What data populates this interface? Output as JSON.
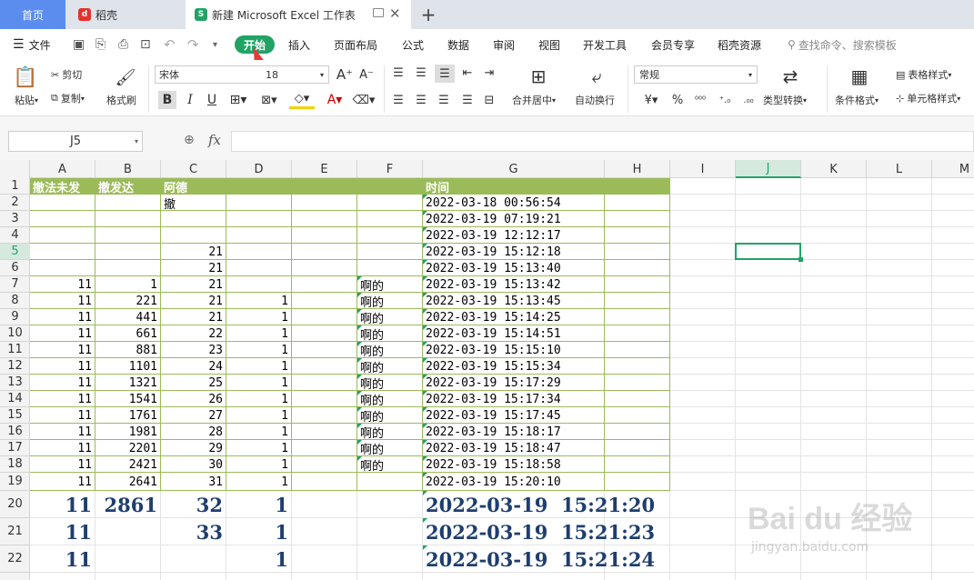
{
  "tabs": {
    "home": "首页",
    "daoke": "稻壳",
    "book": "新建 Microsoft Excel 工作表",
    "book_badge": "S",
    "daoke_badge": "d"
  },
  "menu": {
    "file": "文件",
    "start": "开始",
    "insert": "插入",
    "layout": "页面布局",
    "formula": "公式",
    "data": "数据",
    "review": "审阅",
    "view": "视图",
    "dev": "开发工具",
    "member": "会员专享",
    "daoke_res": "稻壳资源",
    "search_placeholder": "查找命令、搜索模板"
  },
  "ribbon": {
    "paste": "粘贴",
    "cut": "剪切",
    "copy": "复制",
    "format_painter": "格式刷",
    "font_name": "宋体",
    "font_size": "18",
    "merge": "合并居中",
    "wrap": "自动换行",
    "number_format": "常规",
    "convert": "类型转换",
    "cond_format": "条件格式",
    "table_style": "表格样式",
    "cell_style": "单元格样式",
    "percent": "%"
  },
  "formula_bar": {
    "name_box": "J5",
    "fx": "fx",
    "content": ""
  },
  "columns": [
    "A",
    "B",
    "C",
    "D",
    "E",
    "F",
    "G",
    "H",
    "I",
    "J",
    "K",
    "L",
    "M"
  ],
  "rows": [
    "1",
    "2",
    "3",
    "4",
    "5",
    "6",
    "7",
    "8",
    "9",
    "10",
    "11",
    "12",
    "13",
    "14",
    "15",
    "16",
    "17",
    "18",
    "19",
    "20",
    "21",
    "22"
  ],
  "header_row": {
    "a": "撤法未发",
    "b": "撤发达",
    "c": "阿德",
    "g": "时间"
  },
  "cell_c2": "撤",
  "cells": [
    {
      "r": 2,
      "g": "2022-03-18 00:56:54"
    },
    {
      "r": 3,
      "g": "2022-03-19 07:19:21"
    },
    {
      "r": 4,
      "g": "2022-03-19 12:12:17"
    },
    {
      "r": 5,
      "c": "21",
      "g": "2022-03-19 15:12:18"
    },
    {
      "r": 6,
      "c": "21",
      "g": "2022-03-19 15:13:40"
    },
    {
      "r": 7,
      "a": "11",
      "b": "1",
      "c": "21",
      "f": "啊的",
      "g": "2022-03-19 15:13:42"
    },
    {
      "r": 8,
      "a": "11",
      "b": "221",
      "c": "21",
      "d": "1",
      "f": "啊的",
      "g": "2022-03-19 15:13:45"
    },
    {
      "r": 9,
      "a": "11",
      "b": "441",
      "c": "21",
      "d": "1",
      "f": "啊的",
      "g": "2022-03-19 15:14:25"
    },
    {
      "r": 10,
      "a": "11",
      "b": "661",
      "c": "22",
      "d": "1",
      "f": "啊的",
      "g": "2022-03-19 15:14:51"
    },
    {
      "r": 11,
      "a": "11",
      "b": "881",
      "c": "23",
      "d": "1",
      "f": "啊的",
      "g": "2022-03-19 15:15:10"
    },
    {
      "r": 12,
      "a": "11",
      "b": "1101",
      "c": "24",
      "d": "1",
      "f": "啊的",
      "g": "2022-03-19 15:15:34"
    },
    {
      "r": 13,
      "a": "11",
      "b": "1321",
      "c": "25",
      "d": "1",
      "f": "啊的",
      "g": "2022-03-19 15:17:29"
    },
    {
      "r": 14,
      "a": "11",
      "b": "1541",
      "c": "26",
      "d": "1",
      "f": "啊的",
      "g": "2022-03-19 15:17:34"
    },
    {
      "r": 15,
      "a": "11",
      "b": "1761",
      "c": "27",
      "d": "1",
      "f": "啊的",
      "g": "2022-03-19 15:17:45"
    },
    {
      "r": 16,
      "a": "11",
      "b": "1981",
      "c": "28",
      "d": "1",
      "f": "啊的",
      "g": "2022-03-19 15:18:17"
    },
    {
      "r": 17,
      "a": "11",
      "b": "2201",
      "c": "29",
      "d": "1",
      "f": "啊的",
      "g": "2022-03-19 15:18:47"
    },
    {
      "r": 18,
      "a": "11",
      "b": "2421",
      "c": "30",
      "d": "1",
      "f": "啊的",
      "g": "2022-03-19 15:18:58"
    },
    {
      "r": 19,
      "a": "11",
      "b": "2641",
      "c": "31",
      "d": "1",
      "g": "2022-03-19 15:20:10"
    }
  ],
  "big_rows": [
    {
      "r": 20,
      "a": "11",
      "b": "2861",
      "c": "32",
      "d": "1",
      "g": "2022-03-19  15:21:20"
    },
    {
      "r": 21,
      "a": "11",
      "c": "33",
      "d": "1",
      "g": "2022-03-19  15:21:23"
    },
    {
      "r": 22,
      "a": "11",
      "d": "1",
      "g": "2022-03-19  15:21:24"
    }
  ],
  "watermark": {
    "brand": "Bai du 经验",
    "url": "jingyan.baidu.com"
  },
  "colors": {
    "accent": "#21a366",
    "header_fill": "#9bbb59",
    "table_border": "#9bbb59",
    "tab_active": "#5b8def",
    "big_text": "#1f3e6e",
    "selection": "#21a366"
  }
}
